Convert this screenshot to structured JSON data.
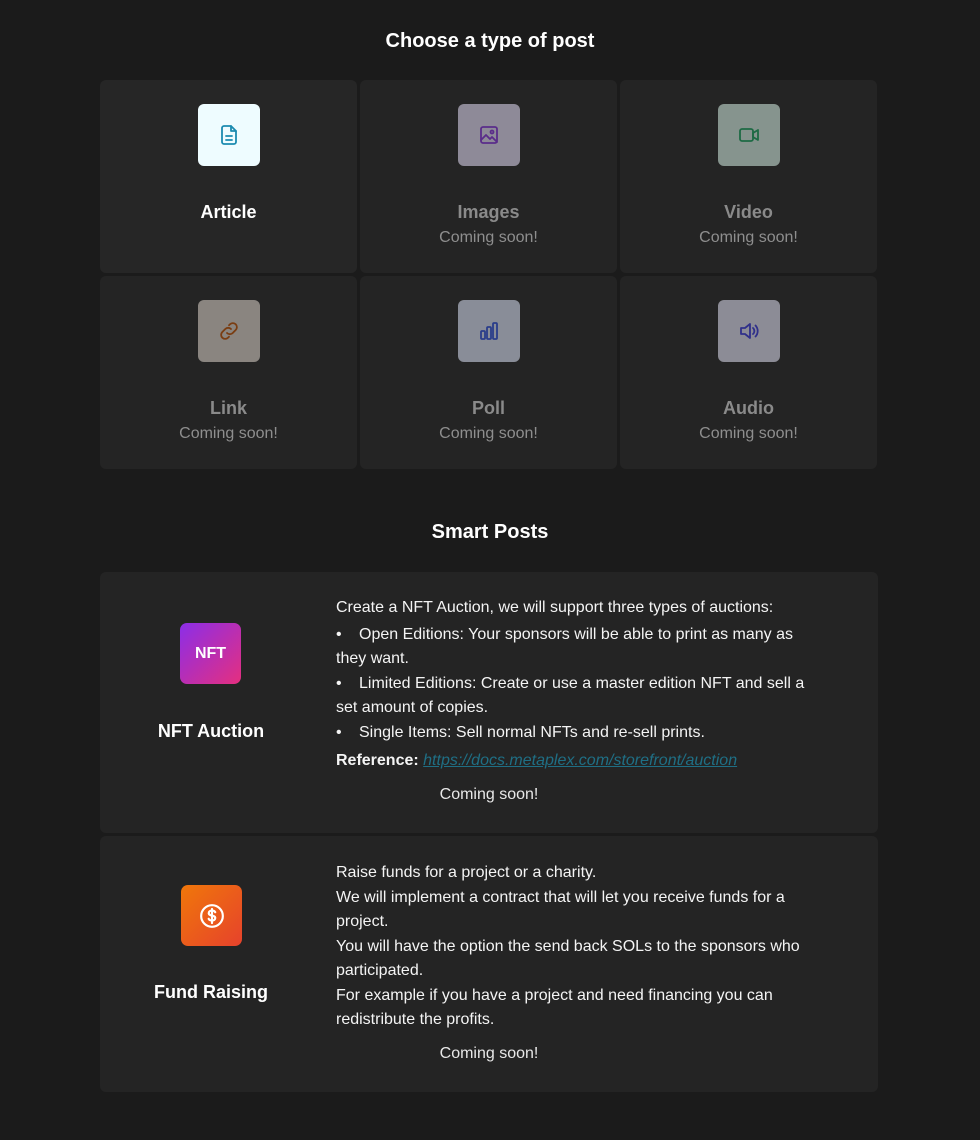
{
  "post_types": {
    "title": "Choose a type of post",
    "items": [
      {
        "label": "Article",
        "status": "",
        "icon": "document-icon",
        "tile_color": "#eefcff",
        "icon_color": "#1b8bb0"
      },
      {
        "label": "Images",
        "status": "Coming soon!",
        "icon": "image-icon",
        "tile_color": "#8e8a98",
        "icon_color": "#5a2c8a"
      },
      {
        "label": "Video",
        "status": "Coming soon!",
        "icon": "video-camera-icon",
        "tile_color": "#86948e",
        "icon_color": "#1d6a44"
      },
      {
        "label": "Link",
        "status": "Coming soon!",
        "icon": "link-icon",
        "tile_color": "#8a8580",
        "icon_color": "#7a3d12"
      },
      {
        "label": "Poll",
        "status": "Coming soon!",
        "icon": "bar-chart-icon",
        "tile_color": "#898d98",
        "icon_color": "#2a3d8a"
      },
      {
        "label": "Audio",
        "status": "Coming soon!",
        "icon": "speaker-icon",
        "tile_color": "#8c8c96",
        "icon_color": "#30308a"
      }
    ]
  },
  "smart_posts": {
    "title": "Smart Posts",
    "nft": {
      "tile_text": "NFT",
      "name": "NFT Auction",
      "intro": "Create a NFT Auction, we will support three types of auctions:",
      "bullets": [
        "Open Editions: Your sponsors will be able to print as many as they want.",
        "Limited Editions: Create or use a master edition NFT and sell a set amount of copies.",
        "Single Items: Sell normal NFTs and re-sell prints."
      ],
      "reference_label": "Reference:",
      "reference_link": "https://docs.metaplex.com/storefront/auction",
      "status": "Coming soon!"
    },
    "fund": {
      "icon": "dollar-coin-icon",
      "name": "Fund Raising",
      "lines": [
        "Raise funds for a project or a charity.",
        "We will implement a contract that will let you receive funds for a project.",
        "You will have the option the send back SOLs to the sponsors who participated.",
        "For example if you have a project and need financing you can redistribute the profits."
      ],
      "status": "Coming soon!"
    }
  }
}
